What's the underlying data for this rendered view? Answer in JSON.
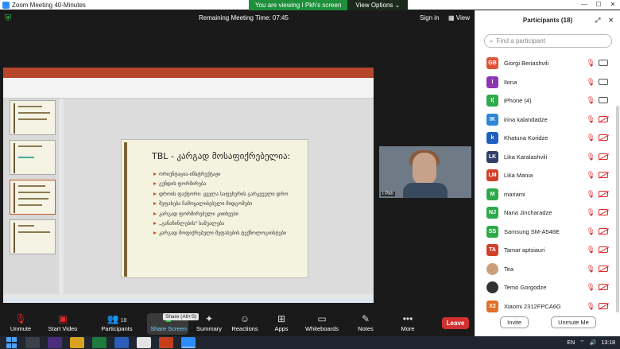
{
  "window": {
    "title": "Zoom Meeting 40-Minutes"
  },
  "share_banner": {
    "message": "You are viewing I Pkh's screen",
    "view_options": "View Options"
  },
  "topbar": {
    "remaining": "Remaining Meeting Time: 07:45",
    "sign_in": "Sign in",
    "view": "View"
  },
  "slide": {
    "title": "TBL - კარგად მოსაფიქრებელია:",
    "bullets": [
      "ორიენტაცია-ინსტრუქტაჟი",
      "გუნდის ფორმირება",
      "დროის ფაქტორი: ყველა საფეხურის გარკვეული დრო",
      "შეფასება ჩამოყალიბებული მიდგომები",
      "კარგად ფორმირებული კითხვები",
      "„განაჩინლების\" საშუალება",
      "კარგად მოფიქრებული შეფასების ტექნოლოგიისტები"
    ]
  },
  "video": {
    "name": "I Pkh"
  },
  "panel": {
    "title": "Participants (18)",
    "search_placeholder": "Find a participant",
    "participants": [
      {
        "initials": "GB",
        "name": "Giorgi Beriashvili",
        "color": "#e0533a"
      },
      {
        "initials": "I",
        "name": "Ilona",
        "color": "#8e35b5"
      },
      {
        "initials": "I(",
        "name": "iPhone (4)",
        "color": "#2eaa4a"
      },
      {
        "initials": "IK",
        "name": "irina kalandadze",
        "color": "#2d86d6"
      },
      {
        "initials": "k",
        "name": "Khatuna Koridze",
        "color": "#1f5fbf"
      },
      {
        "initials": "LK",
        "name": "Lika Karalashvili",
        "color": "#2f3f6a"
      },
      {
        "initials": "LM",
        "name": "Lika Mania",
        "color": "#d0402a"
      },
      {
        "initials": "M",
        "name": "mariami",
        "color": "#2eaa4a"
      },
      {
        "initials": "NJ",
        "name": "Nana Jincharadze",
        "color": "#2eaa4a"
      },
      {
        "initials": "SS",
        "name": "Samsung SM-A546E",
        "color": "#2eaa4a"
      },
      {
        "initials": "TA",
        "name": "Tamar aptsiauri",
        "color": "#d0402a"
      },
      {
        "initials": "",
        "name": "Tea",
        "color": "#c9a07a"
      },
      {
        "initials": "",
        "name": "Temo Gorgodze",
        "color": "#333333"
      },
      {
        "initials": "X2",
        "name": "Xiaomi 2312FPCA6G",
        "color": "#e0702a"
      }
    ],
    "invite": "Invite",
    "unmute_me": "Unmute Me"
  },
  "toolbar": {
    "unmute": "Unmute",
    "start_video": "Start Video",
    "participants": "Participants",
    "participants_count": "18",
    "share_screen": "Share Screen",
    "share_tip": "Share (Alt+S)",
    "summary": "Summary",
    "reactions": "Reactions",
    "apps": "Apps",
    "whiteboards": "Whiteboards",
    "notes": "Notes",
    "more": "More",
    "leave": "Leave"
  },
  "taskbar": {
    "lang": "EN",
    "time": "13:18"
  }
}
